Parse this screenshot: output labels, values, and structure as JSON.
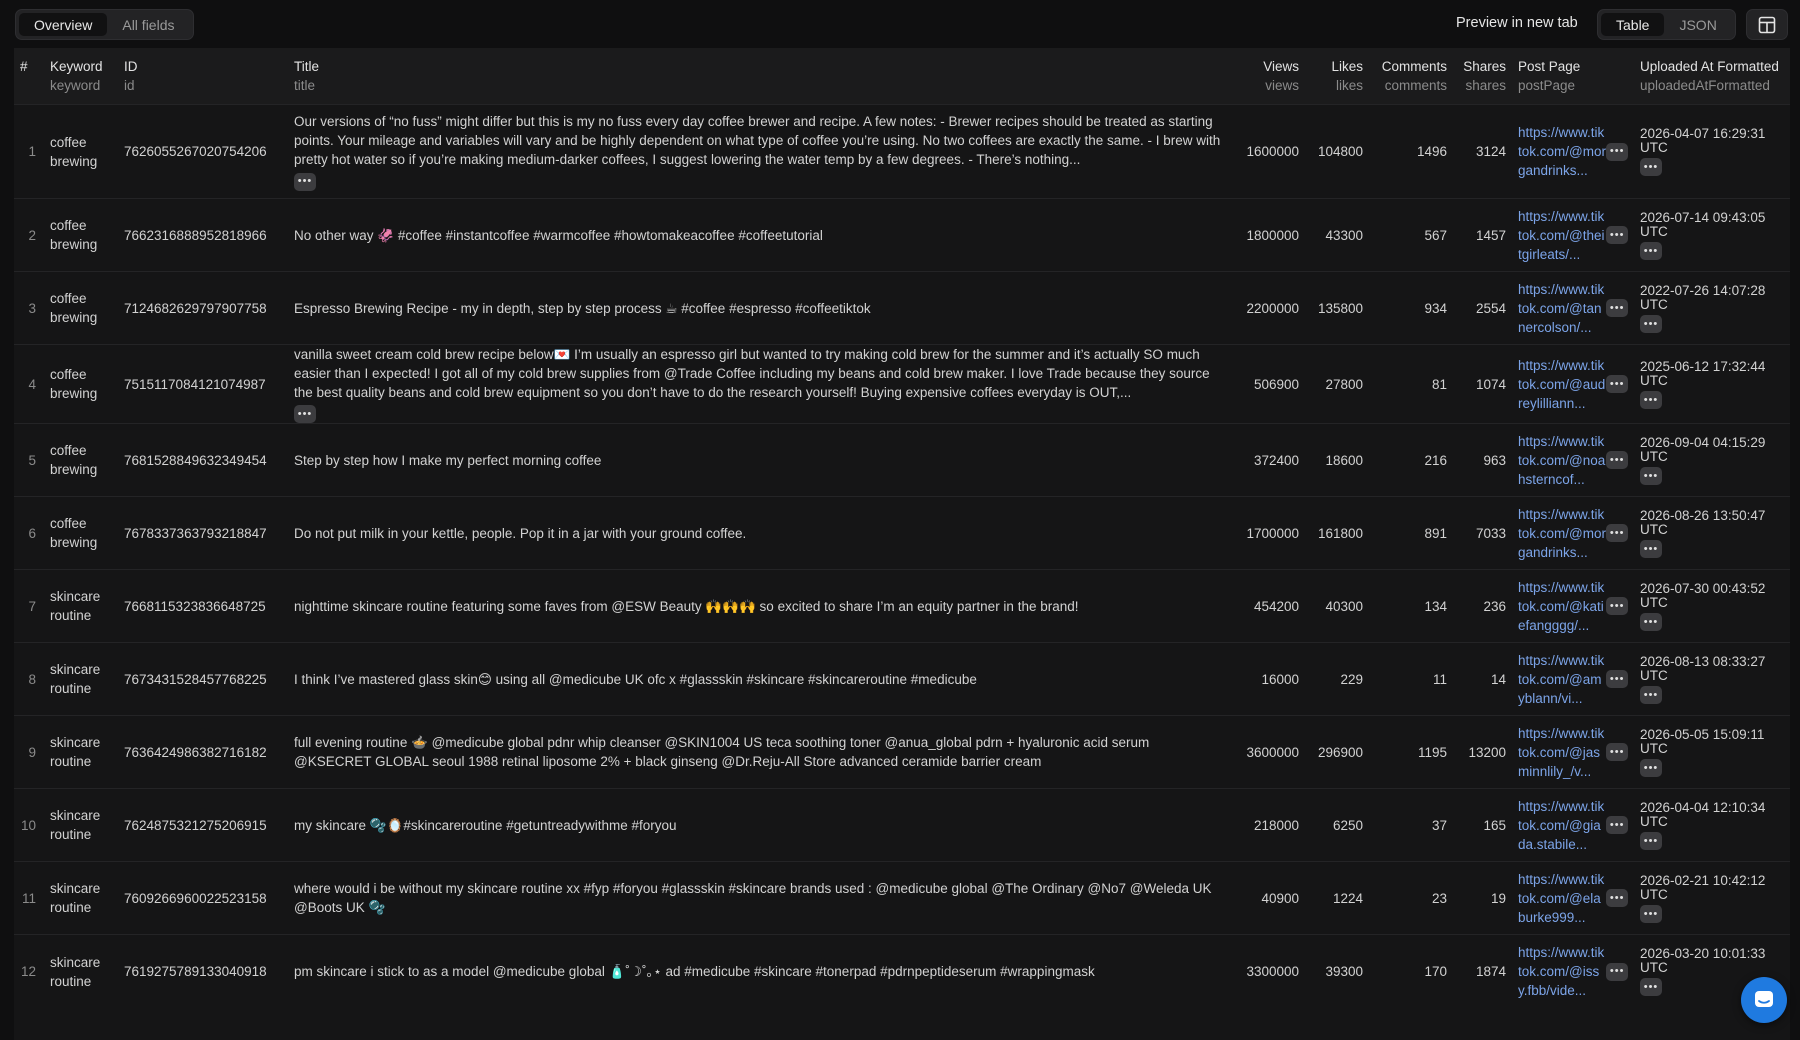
{
  "header": {
    "view_tabs": [
      {
        "label": "Overview",
        "active": true
      },
      {
        "label": "All fields",
        "active": false
      }
    ],
    "preview_label": "Preview in new tab",
    "format_tabs": [
      {
        "label": "Table",
        "active": true
      },
      {
        "label": "JSON",
        "active": false
      }
    ],
    "layout_icon": "layout-panel-icon"
  },
  "columns": {
    "index": "#",
    "keyword": {
      "label": "Keyword",
      "key": "keyword"
    },
    "id": {
      "label": "ID",
      "key": "id"
    },
    "title": {
      "label": "Title",
      "key": "title"
    },
    "views": {
      "label": "Views",
      "key": "views"
    },
    "likes": {
      "label": "Likes",
      "key": "likes"
    },
    "comments": {
      "label": "Comments",
      "key": "comments"
    },
    "shares": {
      "label": "Shares",
      "key": "shares"
    },
    "post_page": {
      "label": "Post Page",
      "key": "postPage"
    },
    "uploaded": {
      "label": "Uploaded At Formatted",
      "key": "uploadedAtFormatted"
    }
  },
  "more_glyph": "•••",
  "rows": [
    {
      "index": "1",
      "keyword": "coffee brewing",
      "id": "7626055267020754206",
      "title": "Our versions of “no fuss” might differ but this is my no fuss every day coffee brewer and recipe. A few notes: - Brewer recipes should be treated as starting points. Your mileage and variables will vary and be highly dependent on what type of coffee you’re using. No two coffees are exactly the same. - I brew with pretty hot water so if you’re making medium-darker coffees, I suggest lowering the water temp by a few degrees. - There’s nothing...",
      "title_more": true,
      "views": "1600000",
      "likes": "104800",
      "comments": "1496",
      "shares": "3124",
      "post_page": "https://www.tiktok.com/@morgandrinks...",
      "uploaded": "2026-04-07 16:29:31 UTC"
    },
    {
      "index": "2",
      "keyword": "coffee brewing",
      "id": "7662316888952818966",
      "title": "No other way 🦑 #coffee #instantcoffee #warmcoffee #howtomakeacoffee #coffeetutorial",
      "title_more": false,
      "views": "1800000",
      "likes": "43300",
      "comments": "567",
      "shares": "1457",
      "post_page": "https://www.tiktok.com/@theitgirleats/...",
      "uploaded": "2026-07-14 09:43:05 UTC"
    },
    {
      "index": "3",
      "keyword": "coffee brewing",
      "id": "7124682629797907758",
      "title": "Espresso Brewing Recipe - my in depth, step by step process ☕ #coffee #espresso #coffeetiktok",
      "title_more": false,
      "views": "2200000",
      "likes": "135800",
      "comments": "934",
      "shares": "2554",
      "post_page": "https://www.tiktok.com/@tannercolson/...",
      "uploaded": "2022-07-26 14:07:28 UTC"
    },
    {
      "index": "4",
      "keyword": "coffee brewing",
      "id": "7515117084121074987",
      "title": "vanilla sweet cream cold brew recipe below💌 I’m usually an espresso girl but wanted to try making cold brew for the summer and it’s actually SO much easier than I expected! I got all of my cold brew supplies from @Trade Coffee including my beans and cold brew maker. I love Trade because they source the best quality beans and cold brew equipment so you don’t have to do the research yourself! Buying expensive coffees everyday is OUT,...",
      "title_more": true,
      "views": "506900",
      "likes": "27800",
      "comments": "81",
      "shares": "1074",
      "post_page": "https://www.tiktok.com/@audreylilliann...",
      "uploaded": "2025-06-12 17:32:44 UTC"
    },
    {
      "index": "5",
      "keyword": "coffee brewing",
      "id": "7681528849632349454",
      "title": "Step by step how I make my perfect morning coffee",
      "title_more": false,
      "views": "372400",
      "likes": "18600",
      "comments": "216",
      "shares": "963",
      "post_page": "https://www.tiktok.com/@noahsterncof...",
      "uploaded": "2026-09-04 04:15:29 UTC"
    },
    {
      "index": "6",
      "keyword": "coffee brewing",
      "id": "7678337363793218847",
      "title": "Do not put milk in your kettle, people. Pop it in a jar with your ground coffee.",
      "title_more": false,
      "views": "1700000",
      "likes": "161800",
      "comments": "891",
      "shares": "7033",
      "post_page": "https://www.tiktok.com/@morgandrinks...",
      "uploaded": "2026-08-26 13:50:47 UTC"
    },
    {
      "index": "7",
      "keyword": "skincare routine",
      "id": "7668115323836648725",
      "title": "nighttime skincare routine featuring some faves from @ESW Beauty 🙌🙌🙌 so excited to share I’m an equity partner in the brand!",
      "title_more": false,
      "views": "454200",
      "likes": "40300",
      "comments": "134",
      "shares": "236",
      "post_page": "https://www.tiktok.com/@katiefangggg/...",
      "uploaded": "2026-07-30 00:43:52 UTC"
    },
    {
      "index": "8",
      "keyword": "skincare routine",
      "id": "7673431528457768225",
      "title": "I think I’ve mastered glass skin😊 using all @medicube UK ofc x #glassskin #skincare #skincareroutine #medicube",
      "title_more": false,
      "views": "16000",
      "likes": "229",
      "comments": "11",
      "shares": "14",
      "post_page": "https://www.tiktok.com/@amyblann/vi...",
      "uploaded": "2026-08-13 08:33:27 UTC"
    },
    {
      "index": "9",
      "keyword": "skincare routine",
      "id": "7636424986382716182",
      "title": "full evening routine 🍲 @medicube global pdnr whip cleanser @SKIN1004 US teca soothing toner @anua_global pdrn + hyaluronic acid serum @KSECRET GLOBAL seoul 1988 retinal liposome 2% + black ginseng @Dr.Reju-All Store advanced ceramide barrier cream",
      "title_more": false,
      "views": "3600000",
      "likes": "296900",
      "comments": "1195",
      "shares": "13200",
      "post_page": "https://www.tiktok.com/@jasminnlily_/v...",
      "uploaded": "2026-05-05 15:09:11 UTC"
    },
    {
      "index": "10",
      "keyword": "skincare routine",
      "id": "7624875321275206915",
      "title": "my skincare 🫧🪞#skincareroutine #getuntreadywithme #foryou",
      "title_more": false,
      "views": "218000",
      "likes": "6250",
      "comments": "37",
      "shares": "165",
      "post_page": "https://www.tiktok.com/@giada.stabile...",
      "uploaded": "2026-04-04 12:10:34 UTC"
    },
    {
      "index": "11",
      "keyword": "skincare routine",
      "id": "7609266960022523158",
      "title": "where would i be without my skincare routine xx #fyp #foryou #glassskin #skincare brands used : @medicube global @The Ordinary @No7 @Weleda UK @Boots UK 🫧",
      "title_more": false,
      "views": "40900",
      "likes": "1224",
      "comments": "23",
      "shares": "19",
      "post_page": "https://www.tiktok.com/@elaburke999...",
      "uploaded": "2026-02-21 10:42:12 UTC"
    },
    {
      "index": "12",
      "keyword": "skincare routine",
      "id": "7619275789133040918",
      "title": "pm skincare i stick to as a model @medicube global 🧴˚☽˚｡⋆ ad #medicube #skincare #tonerpad #pdrnpeptideserum #wrappingmask",
      "title_more": false,
      "views": "3300000",
      "likes": "39300",
      "comments": "170",
      "shares": "1874",
      "post_page": "https://www.tiktok.com/@issy.fbb/vide...",
      "uploaded": "2026-03-20 10:01:33 UTC"
    }
  ]
}
